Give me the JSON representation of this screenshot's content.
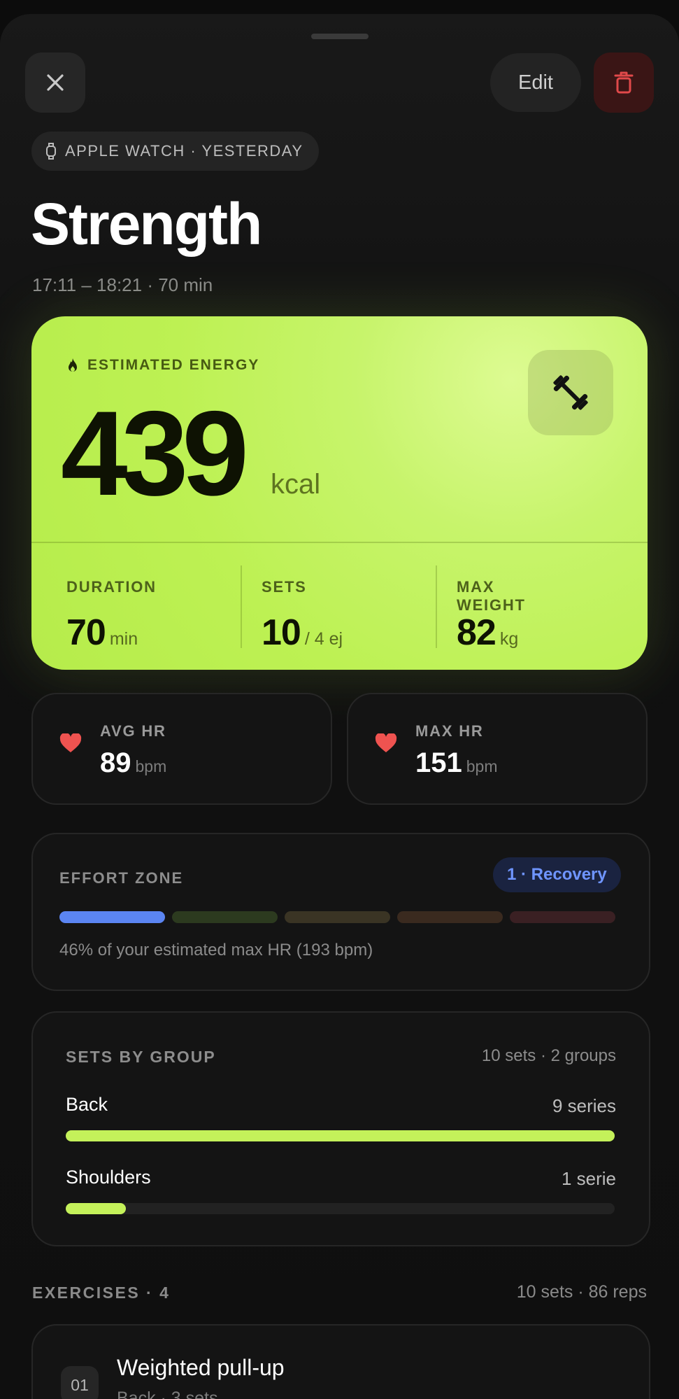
{
  "header": {
    "edit_label": "Edit",
    "source": "APPLE WATCH · YESTERDAY",
    "title": "Strength",
    "time_range": "17:11 – 18:21 · 70 min"
  },
  "energy": {
    "label": "ESTIMATED ENERGY",
    "value": "439",
    "unit": "kcal",
    "stats": [
      {
        "label": "DURATION",
        "value": "70",
        "unit": "min"
      },
      {
        "label": "SETS",
        "value": "10",
        "unit": "/ 4 ej"
      },
      {
        "label": "MAX WEIGHT",
        "value": "82",
        "unit": "kg"
      }
    ]
  },
  "heart_rate": [
    {
      "label": "AVG HR",
      "value": "89",
      "unit": "bpm"
    },
    {
      "label": "MAX HR",
      "value": "151",
      "unit": "bpm"
    }
  ],
  "effort_zone": {
    "label": "EFFORT ZONE",
    "badge": "1 · Recovery",
    "active_zone": 1,
    "zone_colors": [
      "#5b85f2",
      "#2c3a1f",
      "#3a3424",
      "#3a2a1f",
      "#3a2023"
    ],
    "note": "46% of your estimated max HR (193 bpm)"
  },
  "sets_by_group": {
    "label": "SETS BY GROUP",
    "summary": "10 sets · 2 groups",
    "groups": [
      {
        "name": "Back",
        "count": "9 series",
        "fraction": 1.0
      },
      {
        "name": "Shoulders",
        "count": "1 serie",
        "fraction": 0.11
      }
    ]
  },
  "exercises": {
    "header": "EXERCISES · 4",
    "summary": "10 sets · 86 reps",
    "items": [
      {
        "num": "01",
        "name": "Weighted pull-up",
        "meta": "Back · 3 sets"
      }
    ]
  },
  "colors": {
    "accent": "#c4f15a",
    "delete": "#e0494a",
    "heart": "#ef5350",
    "zone_badge_text": "#6f95ff"
  }
}
